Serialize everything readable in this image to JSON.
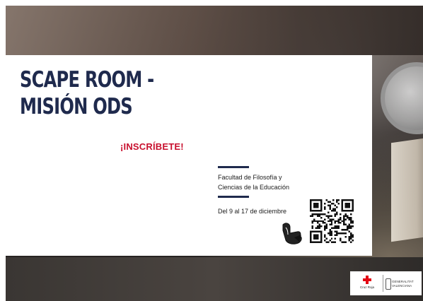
{
  "poster": {
    "title_line1": "SCAPE ROOM -",
    "title_line2": "MISIÓN ODS",
    "cta": "¡INSCRÍBETE!",
    "venue_line1": "Facultad de Filosofía y",
    "venue_line2": "Ciencias de la Educación",
    "dates": "Del 9 al 17 de diciembre"
  },
  "logos": {
    "red_cross_label": "Cruz Roja",
    "gva_line1": "GENERALITAT",
    "gva_line2": "VALENCIANA"
  },
  "colors": {
    "title": "#1f2a4d",
    "cta": "#c8102e",
    "red_cross": "#e30613"
  },
  "icons": {
    "pointer": "hand-pointer-icon",
    "qr": "qr-code",
    "red_cross": "red-cross-logo",
    "gva": "generalitat-logo"
  }
}
